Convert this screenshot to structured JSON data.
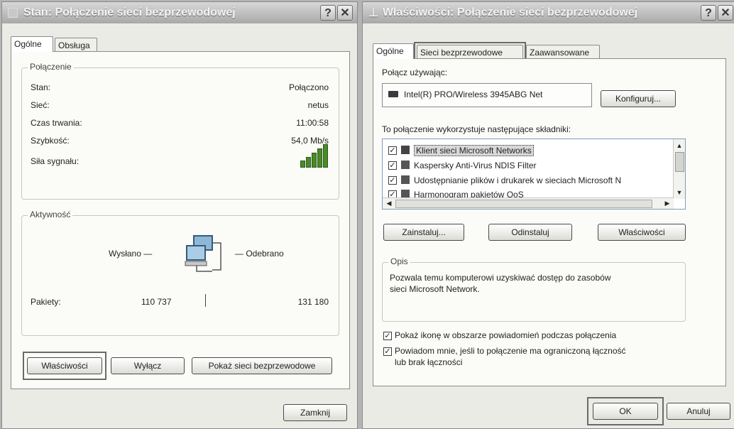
{
  "left_dialog": {
    "title": "Stan: Połączenie sieci bezprzewodowej",
    "help_icon": "?",
    "close_icon": "✕",
    "tabs": [
      "Ogólne",
      "Obsługa"
    ],
    "connection_group": {
      "title": "Połączenie",
      "rows": [
        {
          "label": "Stan:",
          "value": "Połączono"
        },
        {
          "label": "Sieć:",
          "value": "netus"
        },
        {
          "label": "Czas trwania:",
          "value": "11:00:58"
        },
        {
          "label": "Szybkość:",
          "value": "54,0 Mb/s"
        },
        {
          "label": "Siła sygnału:",
          "value": ""
        }
      ],
      "signal_bars": 5
    },
    "activity_group": {
      "title": "Aktywność",
      "sent_label": "Wysłano —",
      "received_label": "— Odebrano",
      "packets_label": "Pakiety:",
      "packets_sent": "110 737",
      "packets_received": "131 180",
      "network_icon": "network-computers-icon"
    },
    "buttons": {
      "properties": "Właściwości",
      "disable": "Wyłącz",
      "show_wireless": "Pokaż sieci bezprzewodowe",
      "close": "Zamknij"
    }
  },
  "right_dialog": {
    "title": "Właściwości: Połączenie sieci bezprzewodowej",
    "help_icon": "?",
    "close_icon": "✕",
    "tabs": [
      "Ogólne",
      "Sieci bezprzewodowe",
      "Zaawansowane"
    ],
    "connect_using_label": "Połącz używając:",
    "adapter_name": "Intel(R) PRO/Wireless 3945ABG Net",
    "configure_button": "Konfiguruj...",
    "components_label": "To połączenie wykorzystuje następujące składniki:",
    "components": [
      {
        "name": "Klient sieci Microsoft Networks",
        "checked": true,
        "selected": true
      },
      {
        "name": "Kaspersky Anti-Virus NDIS Filter",
        "checked": true,
        "selected": false
      },
      {
        "name": "Udostępnianie plików i drukarek w sieciach Microsoft N",
        "checked": true,
        "selected": false
      },
      {
        "name": "Harmonogram pakietów QoS",
        "checked": true,
        "selected": false
      }
    ],
    "install_button": "Zainstaluj...",
    "uninstall_button": "Odinstaluj",
    "properties_button": "Właściwości",
    "description_group": {
      "title": "Opis",
      "text_line1": "Pozwala temu komputerowi uzyskiwać dostęp do zasobów",
      "text_line2": "sieci Microsoft Network."
    },
    "options": [
      {
        "label": "Pokaż ikonę w obszarze powiadomień podczas połączenia",
        "checked": true
      },
      {
        "label": "Powiadom mnie, jeśli to połączenie ma ograniczoną łączność",
        "label2": "lub brak łączności",
        "checked": true
      }
    ],
    "ok_button": "OK",
    "cancel_button": "Anuluj"
  }
}
